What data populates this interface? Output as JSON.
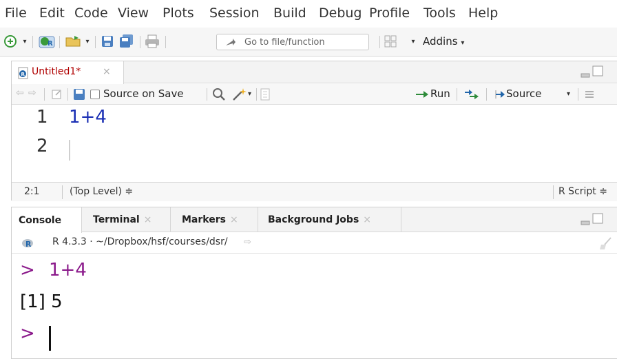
{
  "menu": [
    "File",
    "Edit",
    "Code",
    "View",
    "Plots",
    "Session",
    "Build",
    "Debug",
    "Profile",
    "Tools",
    "Help"
  ],
  "toolbar": {
    "goto_placeholder": "Go to file/function",
    "addins_label": "Addins"
  },
  "editor": {
    "tab_label": "Untitled1*",
    "tab_close": "×",
    "source_on_save_label": "Source on Save",
    "run_label": "Run",
    "source_label": "Source",
    "line_numbers": [
      "1",
      "2"
    ],
    "lines": [
      "1+4",
      ""
    ],
    "status_position": "2:1",
    "status_scope": "(Top Level) ≑",
    "status_type": "R Script ≑"
  },
  "console": {
    "tabs": [
      {
        "label": "Console",
        "close": ""
      },
      {
        "label": "Terminal",
        "close": "×"
      },
      {
        "label": "Markers",
        "close": "×"
      },
      {
        "label": "Background Jobs",
        "close": "×"
      }
    ],
    "path": "R 4.3.3 · ~/Dropbox/hsf/courses/dsr/",
    "prompt": ">",
    "input_cmd": "1+4",
    "output": "[1] 5"
  },
  "colors": {
    "prompt": "#8b1a8b",
    "code_blue": "#1a2fb4",
    "tab_red": "#b00000",
    "run_green": "#2e8b3a"
  }
}
